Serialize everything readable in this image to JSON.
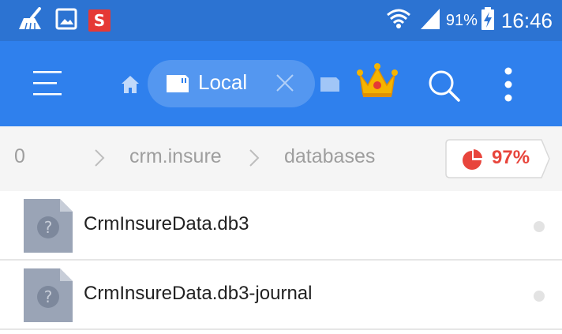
{
  "status_bar": {
    "notification_icons": [
      "broom-icon",
      "image-icon",
      "s-app-icon"
    ],
    "s_badge_letter": "S",
    "battery_percent": "91%",
    "time": "16:46",
    "icons": [
      "wifi-icon",
      "signal-icon",
      "battery-charging-icon"
    ]
  },
  "app_bar": {
    "tab_label": "Local",
    "icons": [
      "menu-icon",
      "home-icon",
      "sdcard-icon",
      "close-icon",
      "sdcard-icon",
      "crown-icon",
      "search-icon",
      "more-vertical-icon"
    ]
  },
  "breadcrumb": {
    "items": [
      "0",
      "crm.insure",
      "databases"
    ],
    "storage_usage": "97%"
  },
  "files": [
    {
      "name": "CrmInsureData.db3",
      "icon": "unknown-file-icon"
    },
    {
      "name": "CrmInsureData.db3-journal",
      "icon": "unknown-file-icon"
    }
  ],
  "colors": {
    "status_bar": "#2c73d2",
    "app_bar": "#2f80ed",
    "breadcrumb_bg": "#f5f5f5",
    "storage_accent": "#e8453c",
    "file_icon": "#9aa4b6"
  }
}
